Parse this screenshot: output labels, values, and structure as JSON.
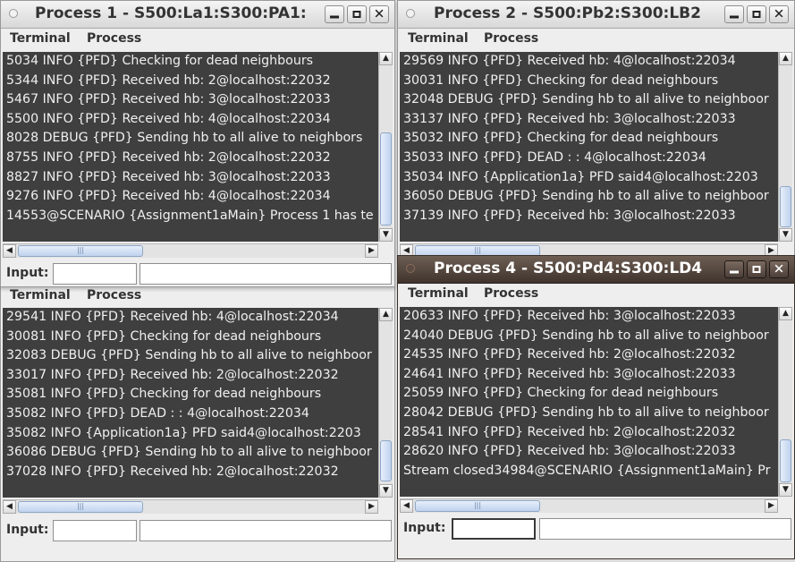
{
  "menu": {
    "terminal": "Terminal",
    "process": "Process"
  },
  "input_label": "Input:",
  "windows": {
    "p1": {
      "title": "Process 1 - S500:La1:S300:PA1:",
      "lines": [
        "5034 INFO  {PFD} Checking for dead neighbours",
        "5344 INFO  {PFD} Received hb: 2@localhost:22032",
        "5467 INFO  {PFD} Received hb: 3@localhost:22033",
        "5500 INFO  {PFD} Received hb: 4@localhost:22034",
        "8028 DEBUG {PFD} Sending hb to all alive to neighbors",
        "8755 INFO  {PFD} Received hb: 2@localhost:22032",
        "8827 INFO  {PFD} Received hb: 3@localhost:22033",
        "9276 INFO  {PFD} Received hb: 4@localhost:22034",
        "14553@SCENARIO {Assignment1aMain} Process 1 has te"
      ]
    },
    "p2": {
      "title": "Process 2 - S500:Pb2:S300:LB2",
      "lines": [
        "29569 INFO  {PFD} Received hb: 4@localhost:22034",
        "30031 INFO  {PFD} Checking for dead neighbours",
        "32048 DEBUG {PFD} Sending hb to all alive to neighboor",
        "33137 INFO  {PFD} Received hb: 3@localhost:22033",
        "35032 INFO  {PFD} Checking for dead neighbours",
        "35033 INFO  {PFD} DEAD : : 4@localhost:22034",
        "35034 INFO  {Application1a} PFD said4@localhost:2203",
        "36050 DEBUG {PFD} Sending hb to all alive to neighboor",
        "37139 INFO  {PFD} Received hb: 3@localhost:22033"
      ]
    },
    "p3": {
      "lines": [
        "29541 INFO  {PFD} Received hb: 4@localhost:22034",
        "30081 INFO  {PFD} Checking for dead neighbours",
        "32083 DEBUG {PFD} Sending hb to all alive to neighboor",
        "33017 INFO  {PFD} Received hb: 2@localhost:22032",
        "35081 INFO  {PFD} Checking for dead neighbours",
        "35082 INFO  {PFD} DEAD : : 4@localhost:22034",
        "35082 INFO  {Application1a} PFD said4@localhost:2203",
        "36086 DEBUG {PFD} Sending hb to all alive to neighboor",
        "37028 INFO  {PFD} Received hb: 2@localhost:22032"
      ]
    },
    "p4": {
      "title": "Process 4 - S500:Pd4:S300:LD4",
      "lines": [
        "20633 INFO  {PFD} Received hb: 3@localhost:22033",
        "24040 DEBUG {PFD} Sending hb to all alive to neighboor",
        "24535 INFO  {PFD} Received hb: 2@localhost:22032",
        "24641 INFO  {PFD} Received hb: 3@localhost:22033",
        "25059 INFO  {PFD} Checking for dead neighbours",
        "28042 DEBUG {PFD} Sending hb to all alive to neighboor",
        "28541 INFO  {PFD} Received hb: 2@localhost:22032",
        "28620 INFO  {PFD} Received hb: 3@localhost:22033",
        "Stream closed34984@SCENARIO {Assignment1aMain} Pr"
      ]
    }
  }
}
